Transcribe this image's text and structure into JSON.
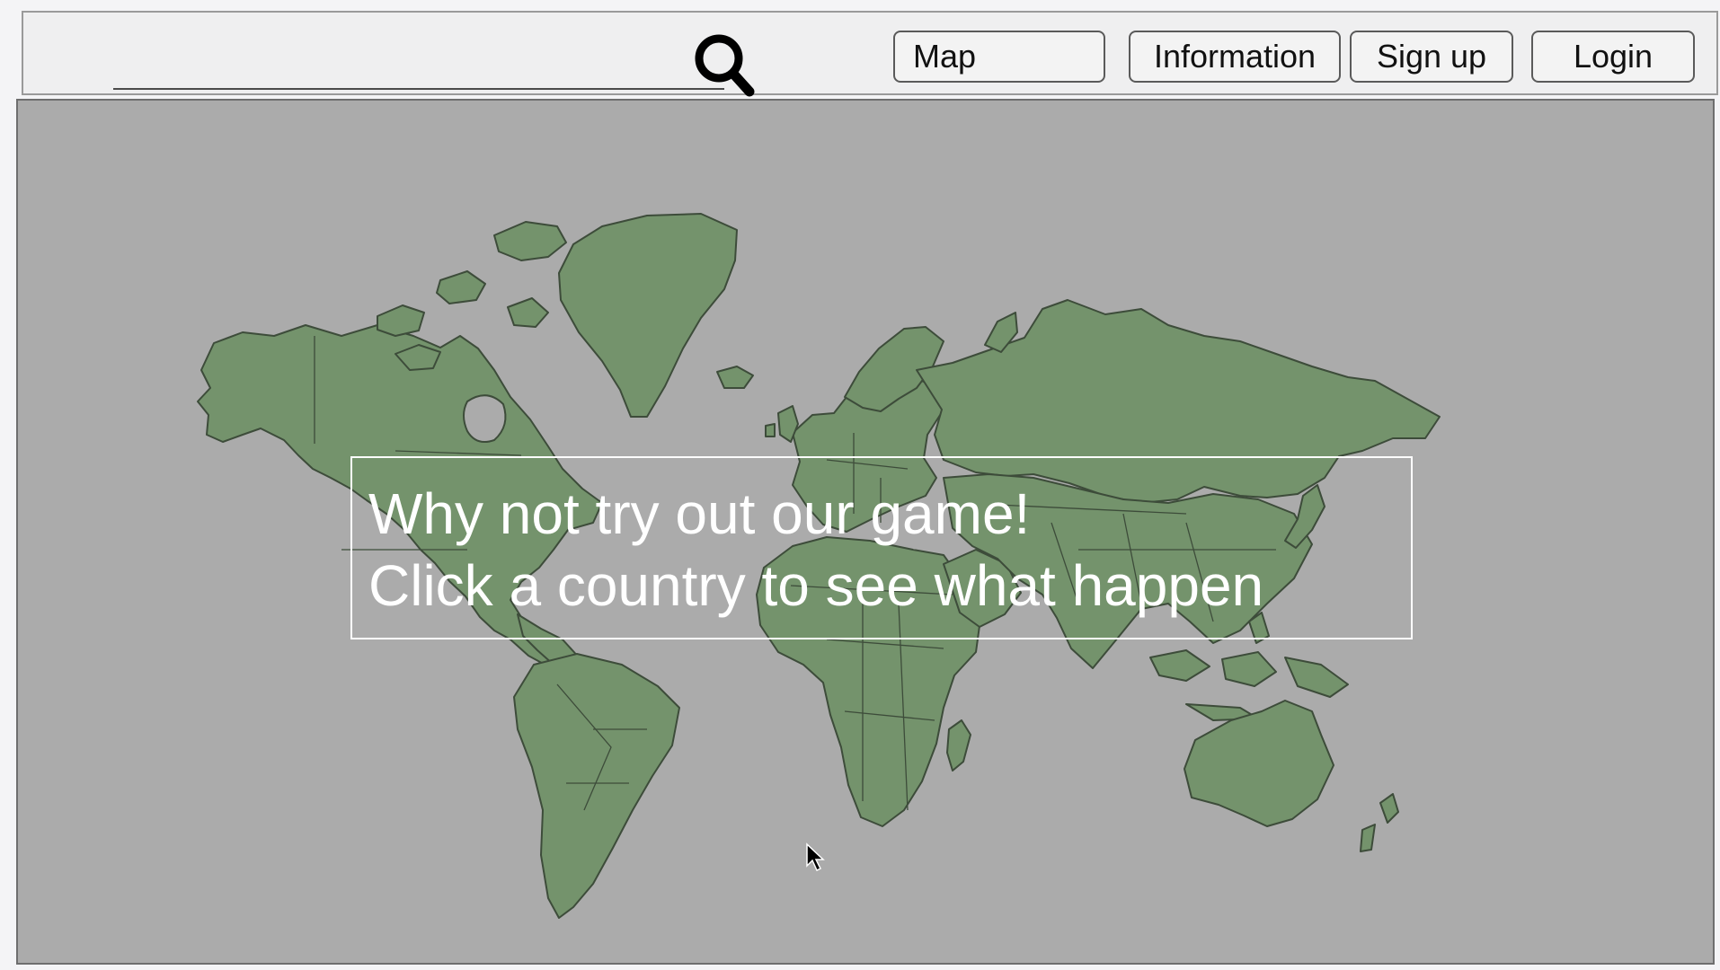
{
  "header": {
    "search": {
      "value": "",
      "placeholder": ""
    },
    "search_button_icon": "search-icon",
    "nav": {
      "map_label": "Map",
      "information_label": "Information",
      "signup_label": "Sign up",
      "login_label": "Login"
    }
  },
  "map": {
    "land_color": "#74936c",
    "water_color": "#ababab",
    "prompt": {
      "line1": "Why not try out our game!",
      "line2": "Click a country to see what happen"
    },
    "cursor_icon": "arrow-cursor-icon"
  }
}
